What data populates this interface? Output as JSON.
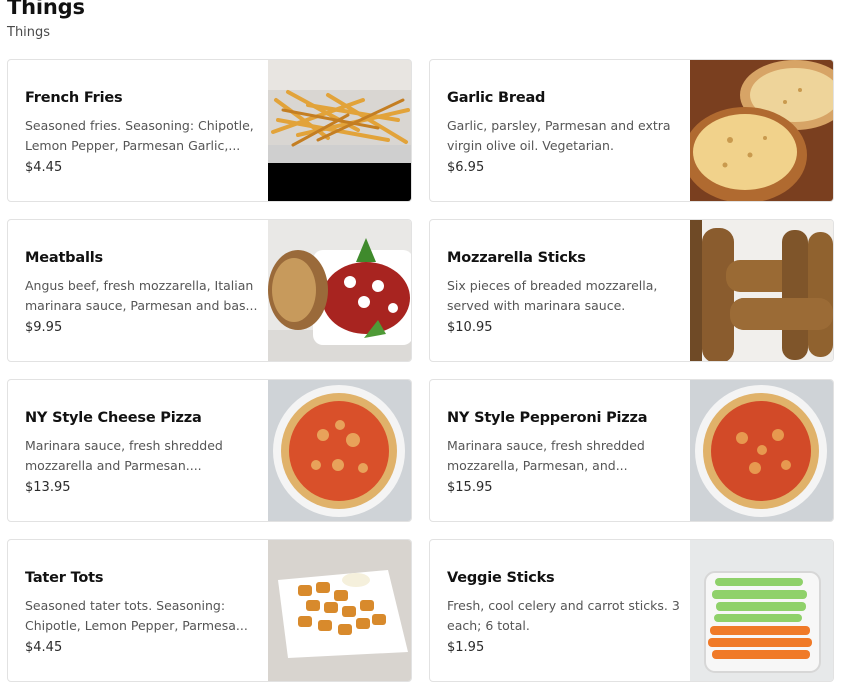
{
  "section": {
    "title": "Things",
    "subtitle": "Things"
  },
  "items": [
    {
      "name": "French Fries",
      "description": "Seasoned fries. Seasoning: Chipotle, Lemon Pepper, Parmesan Garlic,...",
      "price": "$4.45",
      "image_icon": "french-fries-photo"
    },
    {
      "name": "Garlic Bread",
      "description": "Garlic, parsley, Parmesan and extra virgin olive oil. Vegetarian.",
      "price": "$6.95",
      "image_icon": "garlic-bread-photo"
    },
    {
      "name": "Meatballs",
      "description": "Angus beef, fresh mozzarella, Italian marinara sauce, Parmesan and bas...",
      "price": "$9.95",
      "image_icon": "meatballs-photo"
    },
    {
      "name": "Mozzarella Sticks",
      "description": "Six pieces of breaded mozzarella, served with marinara sauce.",
      "price": "$10.95",
      "image_icon": "mozzarella-sticks-photo"
    },
    {
      "name": "NY Style Cheese Pizza",
      "description": "Marinara sauce, fresh shredded mozzarella and Parmesan....",
      "price": "$13.95",
      "image_icon": "cheese-pizza-photo"
    },
    {
      "name": "NY Style Pepperoni Pizza",
      "description": "Marinara sauce, fresh shredded mozzarella, Parmesan, and...",
      "price": "$15.95",
      "image_icon": "pepperoni-pizza-photo"
    },
    {
      "name": "Tater Tots",
      "description": "Seasoned tater tots. Seasoning: Chipotle, Lemon Pepper, Parmesa...",
      "price": "$4.45",
      "image_icon": "tater-tots-photo"
    },
    {
      "name": "Veggie Sticks",
      "description": "Fresh, cool celery and carrot sticks. 3 each; 6 total.",
      "price": "$1.95",
      "image_icon": "veggie-sticks-photo"
    }
  ]
}
